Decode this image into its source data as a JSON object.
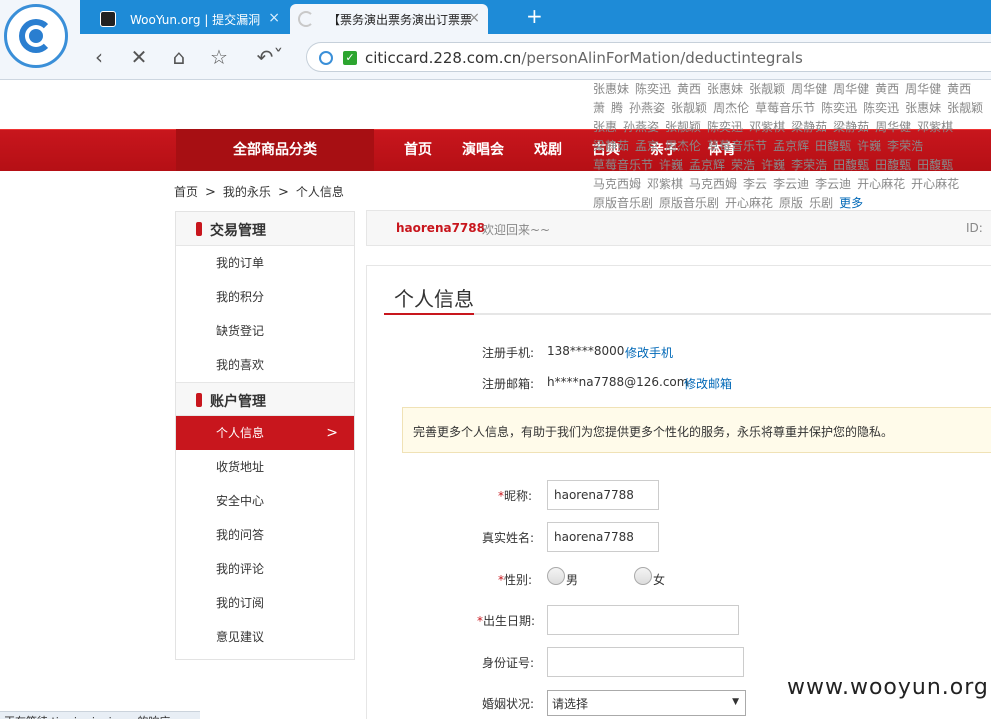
{
  "browser": {
    "tabs": [
      {
        "title": "WooYun.org | 提交漏洞"
      },
      {
        "title": "【票务演出票务演出订票票"
      }
    ],
    "newtab_symbol": "+",
    "url_host": "citiccard.228.com.cn",
    "url_path": "/personAlinForMation/deductintegrals",
    "tab_close_symbol": "×"
  },
  "hot_names": [
    "张惠妹",
    "陈奕迅",
    "黄西",
    "张惠妹",
    "张靓颖",
    "周华健",
    "周华健",
    "黄西",
    "周华健",
    "黄西",
    "萧",
    "腾",
    "孙燕姿",
    "张靓颖",
    "周杰伦",
    "草莓音乐节",
    "陈奕迅",
    "陈奕迅",
    "张惠妹",
    "张靓颖",
    "张惠",
    "孙燕姿",
    "张靓颖",
    "陈奕迅",
    "邓紫棋",
    "梁静茹",
    "梁静茹",
    "周华健",
    "邓紫棋",
    "梁静茹",
    "孟京",
    "周杰伦",
    "草莓音乐节",
    "孟京辉",
    "田馥甄",
    "许巍",
    "李荣浩",
    "草莓音乐节",
    "许巍",
    "孟京辉",
    "荣浩",
    "许巍",
    "李荣浩",
    "田馥甄",
    "田馥甄",
    "田馥甄",
    "马克西姆",
    "邓紫棋",
    "马克西姆",
    "李云",
    "李云迪",
    "李云迪",
    "开心麻花",
    "开心麻花",
    "原版音乐剧",
    "原版音乐剧",
    "开心麻花",
    "原版",
    "乐剧"
  ],
  "hot_more": "更多",
  "nav": {
    "all_categories": "全部商品分类",
    "items": [
      "首页",
      "演唱会",
      "戏剧",
      "古典",
      "亲子",
      "体育"
    ]
  },
  "breadcrumb": [
    "首页",
    "我的永乐",
    "个人信息"
  ],
  "breadcrumb_sep": ">",
  "sidebar": {
    "sections": [
      {
        "title": "交易管理",
        "items": [
          "我的订单",
          "我的积分",
          "缺货登记",
          "我的喜欢"
        ]
      },
      {
        "title": "账户管理",
        "items": [
          "个人信息",
          "收货地址",
          "安全中心",
          "我的问答",
          "我的评论",
          "我的订阅",
          "意见建议"
        ]
      }
    ],
    "active_chevron": ">"
  },
  "welcome": {
    "username": "haorena7788",
    "text": "欢迎回来~~",
    "id_label": "ID:"
  },
  "profile": {
    "title": "个人信息",
    "phone_label": "注册手机:",
    "phone_value": "138****8000",
    "phone_link": "修改手机",
    "email_label": "注册邮箱:",
    "email_value": "h****na7788@126.com",
    "email_link": "修改邮箱",
    "notice": "完善更多个人信息，有助于我们为您提供更多个性化的服务，永乐将尊重并保护您的隐私。",
    "required_mark": "*",
    "nickname_label": "昵称:",
    "nickname_value": "haorena7788",
    "realname_label": "真实姓名:",
    "realname_value": "haorena7788",
    "gender_label": "性别:",
    "gender_male": "男",
    "gender_female": "女",
    "birthday_label": "出生日期:",
    "idcard_label": "身份证号:",
    "marital_label": "婚姻状况:",
    "marital_value": "请选择"
  },
  "status_bar": "正在等待 tjs.sjs.sinajs.cn 的响应...",
  "watermark": "www.wooyun.org",
  "colors": {
    "brand_red": "#c8161d",
    "link_blue": "#0068b7",
    "tab_blue": "#1e8bd7"
  },
  "icons": [
    "back-icon",
    "stop-icon",
    "home-icon",
    "favorite-star-icon",
    "undo-icon",
    "secure-lock-icon"
  ]
}
